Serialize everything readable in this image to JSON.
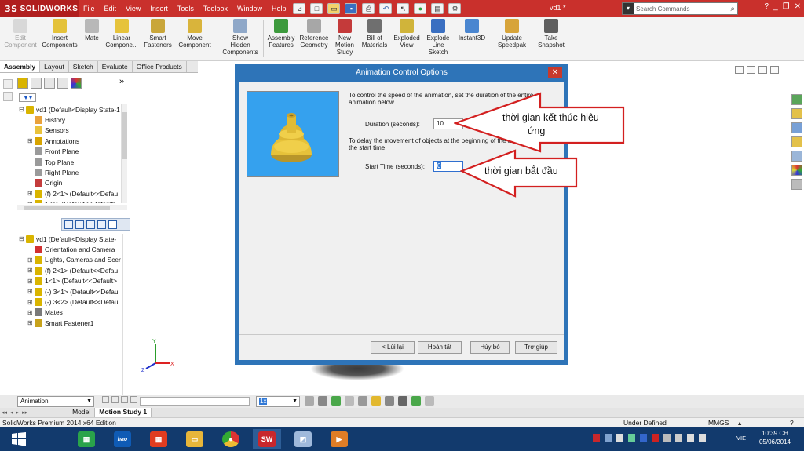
{
  "app": {
    "logo": "SOLIDWORKS",
    "menu": [
      "File",
      "Edit",
      "View",
      "Insert",
      "Tools",
      "Toolbox",
      "Window",
      "Help"
    ],
    "doc_title": "vd1 *",
    "search_placeholder": "Search Commands"
  },
  "ribbon": [
    {
      "label": "Edit\nComponent",
      "disabled": true
    },
    {
      "label": "Insert\nComponents"
    },
    {
      "label": "Mate"
    },
    {
      "label": "Linear\nCompone..."
    },
    {
      "label": "Smart\nFasteners"
    },
    {
      "label": "Move\nComponent"
    },
    {
      "label": "Show\nHidden\nComponents"
    },
    {
      "label": "Assembly\nFeatures"
    },
    {
      "label": "Reference\nGeometry"
    },
    {
      "label": "New\nMotion\nStudy"
    },
    {
      "label": "Bill of\nMaterials"
    },
    {
      "label": "Exploded\nView"
    },
    {
      "label": "Explode\nLine\nSketch"
    },
    {
      "label": "Instant3D"
    },
    {
      "label": "Update\nSpeedpak"
    },
    {
      "label": "Take\nSnapshot"
    }
  ],
  "tabs": [
    "Assembly",
    "Layout",
    "Sketch",
    "Evaluate",
    "Office Products"
  ],
  "tree_top": [
    {
      "label": "vd1  (Default<Display State-1",
      "exp": "⊟",
      "color": "#d9b400"
    },
    {
      "label": "History",
      "color": "#e9a23b",
      "indent": 1
    },
    {
      "label": "Sensors",
      "color": "#e9c23b",
      "indent": 1
    },
    {
      "label": "Annotations",
      "exp": "⊞",
      "color": "#d8a400",
      "indent": 1
    },
    {
      "label": "Front Plane",
      "color": "#9a9a9a",
      "indent": 1
    },
    {
      "label": "Top Plane",
      "color": "#9a9a9a",
      "indent": 1
    },
    {
      "label": "Right Plane",
      "color": "#9a9a9a",
      "indent": 1
    },
    {
      "label": "Origin",
      "color": "#c43c3c",
      "indent": 1
    },
    {
      "label": "(f) 2<1> (Default<<Defau",
      "exp": "⊞",
      "color": "#d9b400",
      "indent": 1
    },
    {
      "label": "1<1> (Default<<Default>_",
      "exp": "⊞",
      "color": "#d9b400",
      "indent": 1
    }
  ],
  "tree_motion": [
    {
      "label": "vd1  (Default<Display State-",
      "exp": "⊟",
      "color": "#d9b400"
    },
    {
      "label": "Orientation and Camera",
      "color": "#d23030",
      "indent": 1
    },
    {
      "label": "Lights, Cameras and Scer",
      "exp": "⊞",
      "color": "#d9b400",
      "indent": 1
    },
    {
      "label": "(f) 2<1> (Default<<Defau",
      "exp": "⊞",
      "color": "#d9b400",
      "indent": 1
    },
    {
      "label": "1<1> (Default<<Default>",
      "exp": "⊞",
      "color": "#d9b400",
      "indent": 1
    },
    {
      "label": "(-) 3<1> (Default<<Defau",
      "exp": "⊞",
      "color": "#d9b400",
      "indent": 1
    },
    {
      "label": "(-) 3<2> (Default<<Defau",
      "exp": "⊞",
      "color": "#d9b400",
      "indent": 1
    },
    {
      "label": "Mates",
      "exp": "⊞",
      "color": "#7a7a7a",
      "indent": 1
    },
    {
      "label": "Smart Fastener1",
      "exp": "⊞",
      "color": "#c7a21b",
      "indent": 1
    }
  ],
  "dialog": {
    "title": "Animation Control Options",
    "close": "✕",
    "text1": "To control the speed of the animation, set the duration of the entire animation below.",
    "duration_label": "Duration (seconds):",
    "duration_value": "10",
    "text2": "To delay the movement of objects at the beginning of the animation, set the start time.",
    "start_label": "Start Time (seconds):",
    "start_value": "0",
    "btn_back": "< Lùi lại",
    "btn_finish": "Hoàn tất",
    "btn_cancel": "Hủy bỏ",
    "btn_help": "Trợ giúp"
  },
  "callouts": {
    "end_line1": "thời gian kết thúc hiệu",
    "end_line2": "ứng",
    "start": "thời gian bắt đầu"
  },
  "animation": {
    "mode": "Animation",
    "speed": "1x"
  },
  "study_tabs": [
    "Model",
    "Motion Study 1"
  ],
  "status": {
    "edition": "SolidWorks Premium 2014 x64 Edition",
    "state": "Under Defined",
    "units": "MMGS",
    "help": "?"
  },
  "taskbar": {
    "lang": "VIE",
    "time": "10:39 CH",
    "date": "05/06/2014"
  },
  "colors": {
    "titlebar": "#c9302c",
    "dialog_frame": "#2e74b8",
    "callout_red": "#d32020",
    "preview_bg": "#35a1ee",
    "part_yellow": "#e6c23a"
  }
}
